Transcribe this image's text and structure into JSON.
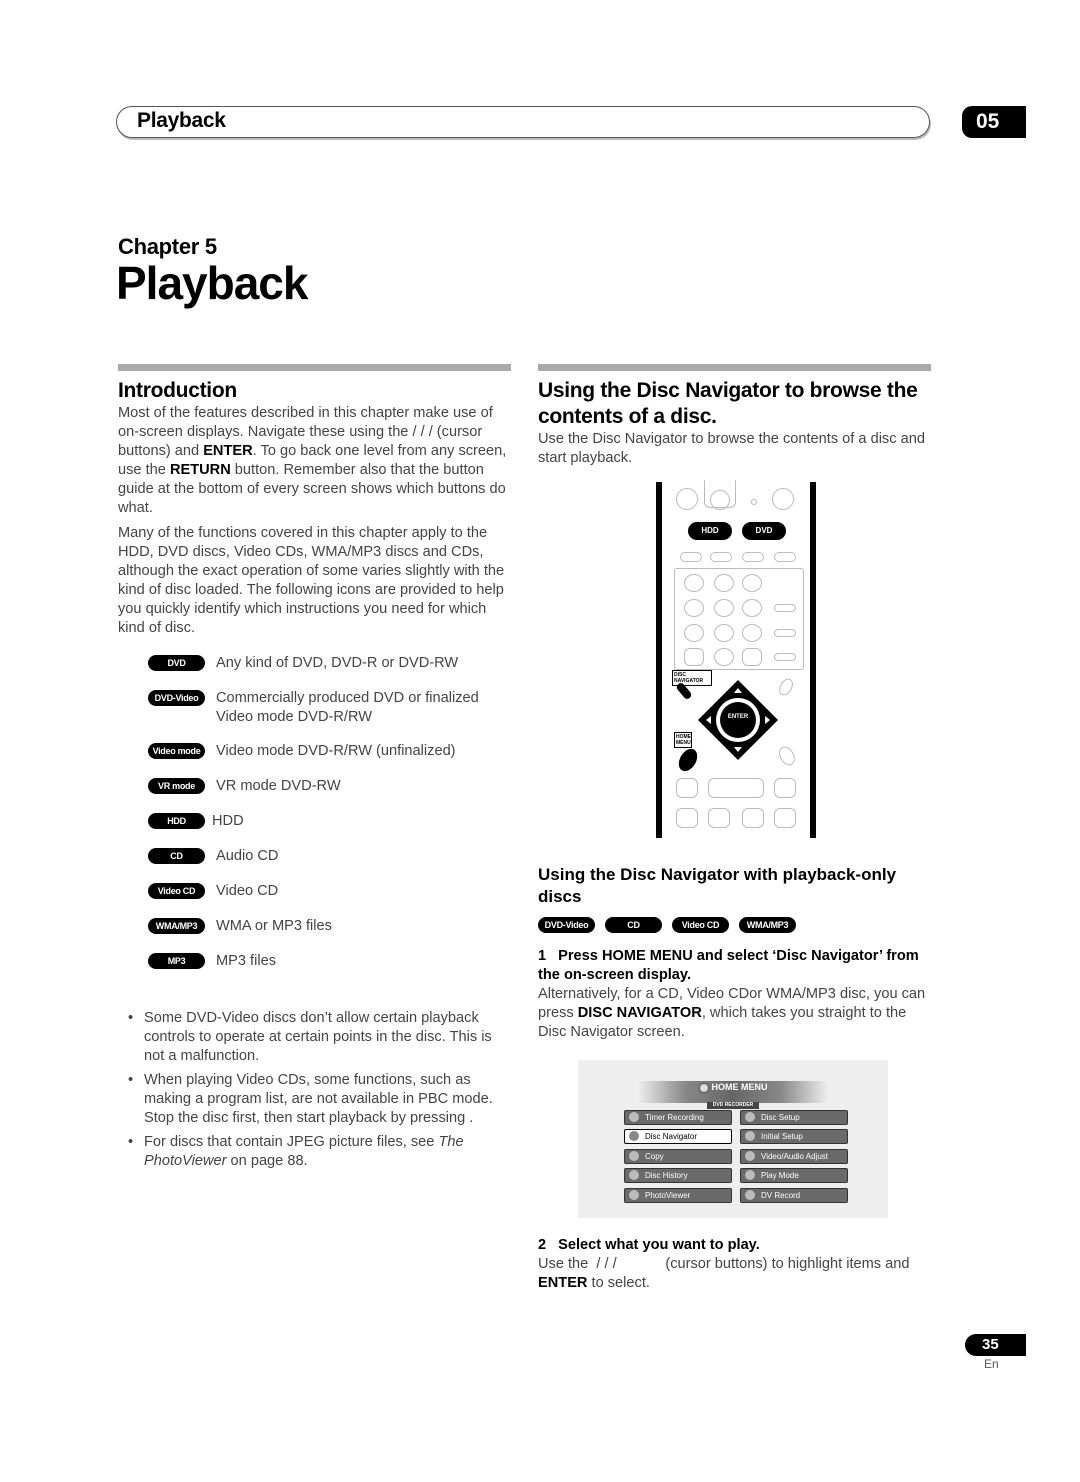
{
  "header": {
    "section_title": "Playback",
    "chapter_number": "05"
  },
  "chapter": {
    "label": "Chapter 5",
    "title": "Playback"
  },
  "introduction": {
    "title": "Introduction",
    "paragraphs": [
      {
        "parts": [
          "Most of the features described in this chapter make use of on-screen displays. Navigate these using the  / / /       (cursor buttons) and ",
          "ENTER",
          ". To go back one level from any screen, use the ",
          "RETURN",
          " button. Remember also that the button guide at the bottom of every screen shows which buttons do what."
        ]
      },
      {
        "text": "Many of the functions covered in this chapter apply to the HDD, DVD discs, Video CDs, WMA/MP3 discs and CDs, although the exact operation of some varies slightly with the kind of disc loaded. The following icons are provided to help you quickly identify which instructions you need for which kind of disc."
      }
    ],
    "icons": [
      {
        "badge": "DVD",
        "description": "Any kind of DVD, DVD-R or DVD-RW"
      },
      {
        "badge": "DVD-Video",
        "description": "Commercially produced DVD or finalized Video mode DVD-R/RW"
      },
      {
        "badge": "Video mode",
        "description": "Video mode DVD-R/RW (unfinalized)"
      },
      {
        "badge": "VR mode",
        "description": "VR mode DVD-RW"
      },
      {
        "badge": "HDD",
        "description": "HDD"
      },
      {
        "badge": "CD",
        "description": "Audio CD"
      },
      {
        "badge": "Video CD",
        "description": "Video CD"
      },
      {
        "badge": "WMA/MP3",
        "description": "WMA or MP3 files"
      },
      {
        "badge": "MP3",
        "description": "MP3 files"
      }
    ],
    "notes": [
      {
        "text": "Some DVD-Video discs don’t allow certain playback controls to operate at certain points in the disc. This is not a malfunction."
      },
      {
        "text": "When playing Video CDs, some functions, such as making a program list, are not available in PBC mode. Stop the disc first, then start playback by pressing       ."
      },
      {
        "before": "For discs that contain JPEG picture files, see ",
        "italic": "The PhotoViewer",
        "after": " on page 88."
      }
    ]
  },
  "disc_navigator": {
    "title": "Using the Disc Navigator to browse the contents of a disc.",
    "intro": "Use the Disc Navigator to browse the contents of a disc and start playback.",
    "remote": {
      "hdd_button": "HDD",
      "dvd_button": "DVD",
      "disc_navigator_label": "DISC NAVIGATOR",
      "home_menu_label_1": "HOME",
      "home_menu_label_2": "MENU",
      "enter_button": "ENTER"
    },
    "subsection": {
      "title": "Using the Disc Navigator with playback-only discs",
      "badges": [
        "DVD-Video",
        "CD",
        "Video CD",
        "WMA/MP3"
      ],
      "step1": {
        "number": "1",
        "heading": "Press HOME MENU and select ‘Disc Navigator’ from the on-screen display.",
        "body_before": "Alternatively, for a CD, Video CDor WMA/MP3 disc, you can press ",
        "body_bold": "DISC NAVIGATOR",
        "body_after": ", which takes you straight to the Disc Navigator screen."
      },
      "home_menu_screen": {
        "title": "HOME MENU",
        "subtitle": "DVD RECORDER",
        "left_items": [
          "Timer Recording",
          "Disc Navigator",
          "Copy",
          "Disc History",
          "PhotoViewer"
        ],
        "right_items": [
          "Disc Setup",
          "Initial Setup",
          "Video/Audio Adjust",
          "Play Mode",
          "DV Record"
        ],
        "selected": "Disc Navigator"
      },
      "step2": {
        "number": "2",
        "heading": "Select what you want to play.",
        "body_before": "Use the  / / /            (cursor buttons) to highlight items and ",
        "body_bold": "ENTER",
        "body_after": " to select."
      }
    }
  },
  "footer": {
    "page_number": "35",
    "language": "En"
  }
}
